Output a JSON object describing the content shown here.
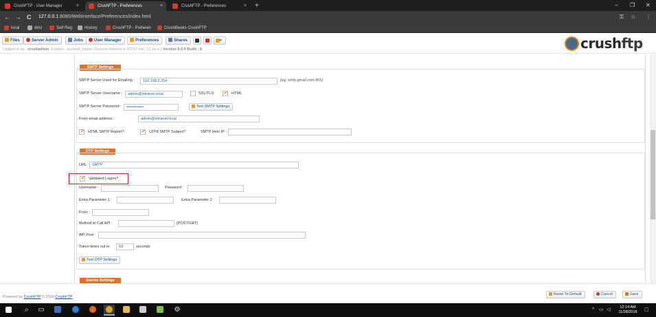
{
  "browser": {
    "tabs": [
      {
        "title": "CrushFTP - User Manager",
        "close": "×"
      },
      {
        "title": "CrushFTP - Preferences",
        "close": "×"
      },
      {
        "title": "CrushFTP - Preferences",
        "close": "×"
      }
    ],
    "new_tab": "+",
    "window_controls": {
      "minimize": "–",
      "maximize": "❐",
      "close": "✕"
    },
    "nav": {
      "back": "←",
      "forward": "→",
      "reload": "C"
    },
    "url": {
      "host": "127.0.0.1",
      "rest": ":8080/WebInterface/Preferences/index.html"
    },
    "addr_icons": {
      "key": "⚿",
      "star": "☆",
      "menu": "⋮"
    },
    "bookmarks": [
      "local",
      "dmz",
      "Self Reg",
      "History",
      "CrushFTP - Preferen",
      "CrushBeeks CrushFTP"
    ]
  },
  "toolbar": {
    "buttons": [
      "Files",
      "Server Admin",
      "Jobs",
      "User Manager",
      "Preferences",
      "Shares"
    ],
    "status": {
      "prefix": "Logged in as : ",
      "user": "crushadmin",
      "middle": ", Expires : account_expire  (Session timeout in 32767 min, 21 secs.)  ",
      "version": "Version 9.0.0 Build : 9"
    },
    "logo": {
      "text_a": "crush",
      "text_b": "ftp"
    }
  },
  "smtp": {
    "heading": "SMTP Settings",
    "server_label": "SMTP Server Used for Emailing :",
    "server_value": "192.168.3.254",
    "server_hint": "(eg. smtp.gmail.com:465)",
    "username_label": "SMTP Server Username :",
    "username_value": "admin@intranet.local",
    "ssl_label": "SSL/TLS",
    "ssl_checked": false,
    "html_label": "HTML",
    "html_checked": true,
    "password_label": "SMTP Server Password :",
    "password_value": "•••••••••••••",
    "test_button": "Test SMTP Settings",
    "from_label": "From email address :",
    "from_value": "admin@intranet.local",
    "report_label": "HTML SMTP Report?",
    "report_checked": true,
    "utf8_label": "UTF8 SMTP Subject?",
    "utf8_checked": true,
    "helo_label": "SMTP Helo IP :",
    "helo_value": ""
  },
  "otp": {
    "heading": "OTP Settings",
    "url_label": "URL :",
    "url_value": "SMTP",
    "validated_label": "Validated Logins?",
    "validated_checked": true,
    "username_label": "Username :",
    "password_label": "Password :",
    "extra1_label": "Extra Parameter 1 :",
    "extra2_label": "Extra Parameter 2 :",
    "from_label": "From :",
    "method_label": "Method to Call API :",
    "method_hint": "(POST/GET)",
    "apipost_label": "API Post :",
    "timeout_label": "Token times out in",
    "timeout_value": "60",
    "timeout_unit": "seconds",
    "test_button": "Test OTP Settings"
  },
  "events": {
    "heading": "Events Settings"
  },
  "footer": {
    "powered_prefix": "Powered by ",
    "powered_link": "CrushFTP",
    "copyright": " © 2018 ",
    "copyright_link": "CrushFTP",
    "reset_button": "Reset To Default",
    "cancel_button": "Cancel",
    "save_button": "Save"
  },
  "taskbar": {
    "time": "12:14 AM",
    "date": "11/28/2018"
  },
  "colors": {
    "accent": "#e27421",
    "link": "#1a4f86",
    "highlight": "#e02020"
  }
}
